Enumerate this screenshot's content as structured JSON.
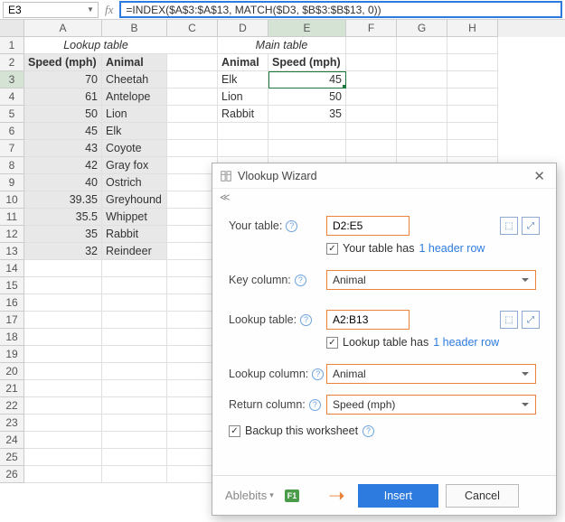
{
  "namebox": {
    "value": "E3"
  },
  "formula": "=INDEX($A$3:$A$13, MATCH($D3, $B$3:$B$13, 0))",
  "columns": [
    "A",
    "B",
    "C",
    "D",
    "E",
    "F",
    "G",
    "H"
  ],
  "lookup_title": "Lookup table",
  "main_title": "Main table",
  "headers": {
    "speed": "Speed (mph)",
    "animal": "Animal"
  },
  "lookup_rows": [
    {
      "speed": "70",
      "animal": "Cheetah"
    },
    {
      "speed": "61",
      "animal": "Antelope"
    },
    {
      "speed": "50",
      "animal": "Lion"
    },
    {
      "speed": "45",
      "animal": "Elk"
    },
    {
      "speed": "43",
      "animal": "Coyote"
    },
    {
      "speed": "42",
      "animal": "Gray fox"
    },
    {
      "speed": "40",
      "animal": "Ostrich"
    },
    {
      "speed": "39.35",
      "animal": "Greyhound"
    },
    {
      "speed": "35.5",
      "animal": "Whippet"
    },
    {
      "speed": "35",
      "animal": "Rabbit"
    },
    {
      "speed": "32",
      "animal": "Reindeer"
    }
  ],
  "main_rows": [
    {
      "animal": "Elk",
      "speed": "45"
    },
    {
      "animal": "Lion",
      "speed": "50"
    },
    {
      "animal": "Rabbit",
      "speed": "35"
    }
  ],
  "wizard": {
    "title": "Vlookup Wizard",
    "your_table_label": "Your table:",
    "your_table_value": "D2:E5",
    "your_table_check": "Your table has",
    "header_row_link": "1 header row",
    "key_col_label": "Key column:",
    "key_col_value": "Animal",
    "lookup_table_label": "Lookup table:",
    "lookup_table_value": "A2:B13",
    "lookup_table_check": "Lookup table has",
    "lookup_col_label": "Lookup column:",
    "lookup_col_value": "Animal",
    "return_col_label": "Return column:",
    "return_col_value": "Speed (mph)",
    "backup_label": "Backup this worksheet",
    "brand": "Ablebits",
    "f1": "F1",
    "insert": "Insert",
    "cancel": "Cancel"
  }
}
